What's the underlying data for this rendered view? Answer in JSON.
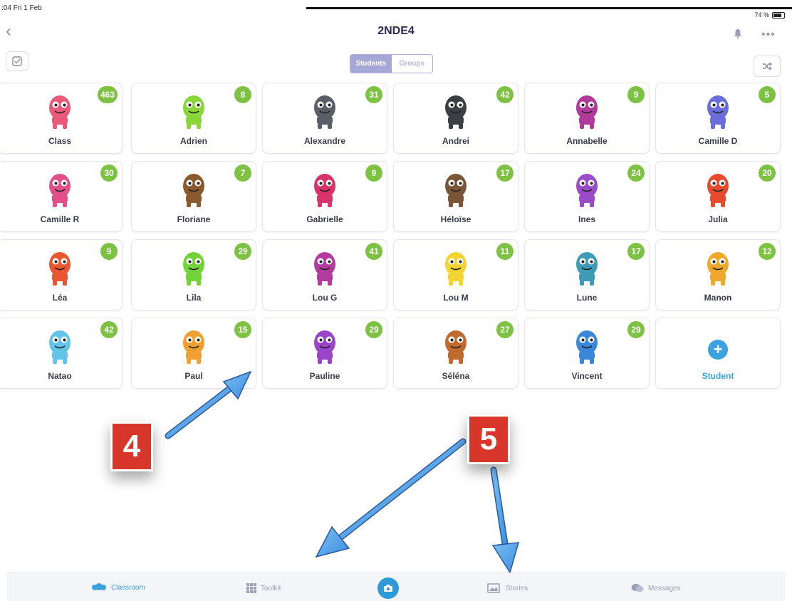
{
  "status": {
    "time": ":04  Fri 1 Feb",
    "battery": "74 %"
  },
  "header": {
    "title": "2NDE4"
  },
  "segment": {
    "students": "Students",
    "groups": "Groups"
  },
  "cards": [
    {
      "name": "Class",
      "points": "463",
      "color": "#e95a7a"
    },
    {
      "name": "Adrien",
      "points": "8",
      "color": "#8ad63a"
    },
    {
      "name": "Alexandre",
      "points": "31",
      "color": "#5a5e66"
    },
    {
      "name": "Andrei",
      "points": "42",
      "color": "#3d3d44"
    },
    {
      "name": "Annabelle",
      "points": "9",
      "color": "#b03a9a"
    },
    {
      "name": "Camille D",
      "points": "5",
      "color": "#6a6ed8"
    },
    {
      "name": "Camille R",
      "points": "30",
      "color": "#e2508a"
    },
    {
      "name": "Floriane",
      "points": "7",
      "color": "#8a5a2c"
    },
    {
      "name": "Gabrielle",
      "points": "9",
      "color": "#d8336a"
    },
    {
      "name": "Héloïse",
      "points": "17",
      "color": "#7b5538"
    },
    {
      "name": "Ines",
      "points": "24",
      "color": "#9a4bc8"
    },
    {
      "name": "Julia",
      "points": "20",
      "color": "#e64b2e"
    },
    {
      "name": "Léa",
      "points": "9",
      "color": "#e8572f"
    },
    {
      "name": "Lila",
      "points": "29",
      "color": "#73d43a"
    },
    {
      "name": "Lou G",
      "points": "41",
      "color": "#b33a9e"
    },
    {
      "name": "Lou M",
      "points": "11",
      "color": "#f3d430"
    },
    {
      "name": "Lune",
      "points": "17",
      "color": "#3d9bb8"
    },
    {
      "name": "Manon",
      "points": "12",
      "color": "#f0a82a"
    },
    {
      "name": "Natao",
      "points": "42",
      "color": "#62c4e8"
    },
    {
      "name": "Paul",
      "points": "15",
      "color": "#f0a030"
    },
    {
      "name": "Pauline",
      "points": "29",
      "color": "#9a45c8"
    },
    {
      "name": "Séléna",
      "points": "27",
      "color": "#c06a30"
    },
    {
      "name": "Vincent",
      "points": "29",
      "color": "#3a86d8"
    }
  ],
  "add_student": {
    "label": "Student"
  },
  "annotations": {
    "four": "4",
    "five": "5"
  },
  "tabs": {
    "classroom": "Classroom",
    "toolkit": "Toolkit",
    "stories": "Stories",
    "messages": "Messages"
  },
  "colors": {
    "points_badge": "#7dc243",
    "accent_blue": "#3aa2e0",
    "annotation_red": "#d9362b"
  }
}
